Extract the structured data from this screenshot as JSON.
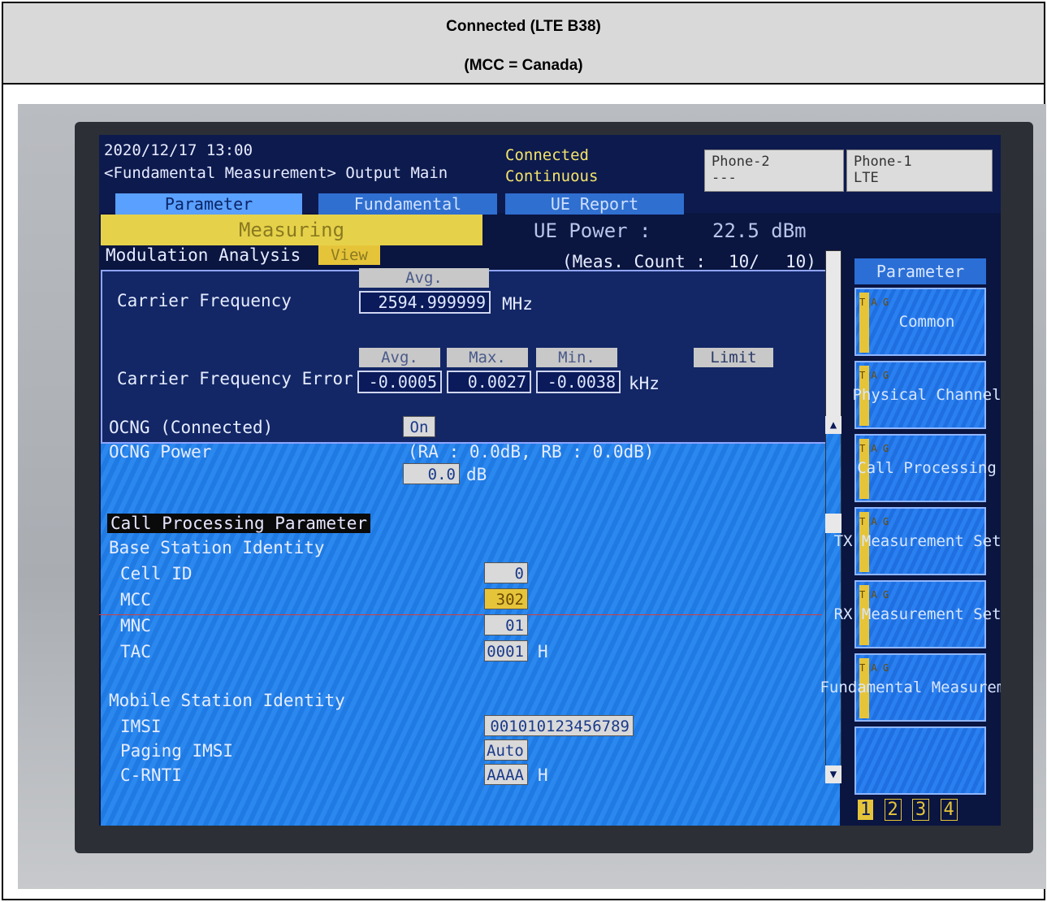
{
  "caption": {
    "line1": "Connected (LTE B38)",
    "line2": "(MCC = Canada)"
  },
  "status": {
    "datetime": "2020/12/17 13:00",
    "mode": "<Fundamental Measurement> Output Main",
    "conn1": "Connected",
    "conn2": "Continuous",
    "phone2_label": "Phone-2",
    "phone2_value": "---",
    "phone1_label": "Phone-1",
    "phone1_value": "LTE"
  },
  "tabs": [
    "Parameter",
    "Fundamental",
    "UE Report"
  ],
  "measuring": "Measuring",
  "ue_power": {
    "label": "UE Power :",
    "value": "22.5 dBm"
  },
  "modulation": {
    "title": "Modulation Analysis",
    "view": "View",
    "meas_count": "(Meas. Count :",
    "count_val": "10/",
    "count_total": "10)",
    "carrier_freq_label": "Carrier Frequency",
    "avg_header": "Avg.",
    "carrier_freq_value": "2594.999999",
    "freq_unit": "MHz",
    "cfe_label": "Carrier Frequency Error",
    "headers": [
      "Avg.",
      "Max.",
      "Min."
    ],
    "limit": "Limit",
    "cfe_values": [
      "-0.0005",
      "0.0027",
      "-0.0038"
    ],
    "cfe_unit": "kHz"
  },
  "params": {
    "ocng_connected": "OCNG (Connected)",
    "ocng_on": "On",
    "ocng_power": "OCNG Power",
    "ocng_ra_rb": "(RA :     0.0dB, RB :     0.0dB)",
    "ocng_value": "0.0",
    "db_unit": "dB",
    "cpp": "Call Processing Parameter",
    "bsi": "Base Station Identity",
    "cell_id_label": "Cell ID",
    "cell_id": "0",
    "mcc_label": "MCC",
    "mcc": "302",
    "mnc_label": "MNC",
    "mnc": "01",
    "tac_label": "TAC",
    "tac": "0001",
    "h_unit": "H",
    "msi": "Mobile Station Identity",
    "imsi_label": "IMSI",
    "imsi": "001010123456789",
    "paging_label": "Paging IMSI",
    "paging": "Auto",
    "crnti_label": "C-RNTI",
    "crnti": "AAAA"
  },
  "side": {
    "title": "Parameter",
    "buttons": [
      "Common",
      "Physical Channel",
      "Call Processing",
      "TX Measurement Setup",
      "RX Measurement Setup",
      "Fundamental Measurement",
      ""
    ],
    "pages": [
      "1",
      "2",
      "3",
      "4"
    ]
  }
}
